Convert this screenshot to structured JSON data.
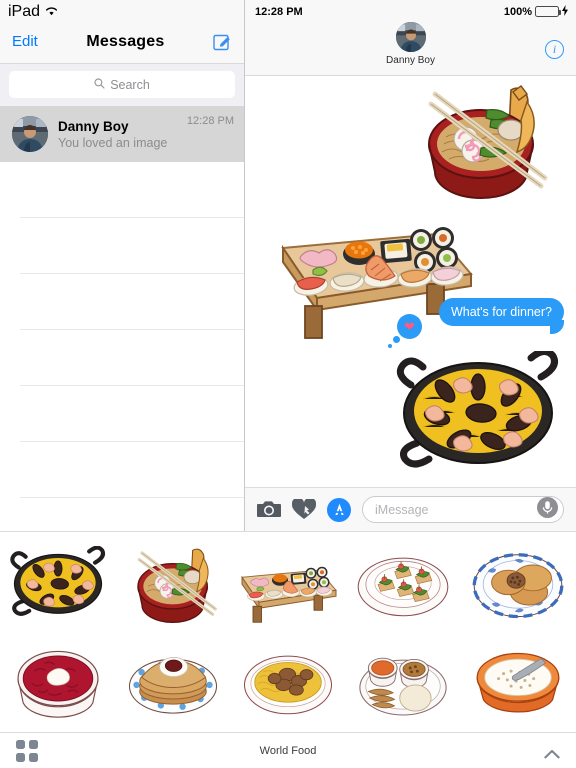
{
  "sidebar": {
    "status": {
      "device": "iPad",
      "wifi_icon": "wifi-icon"
    },
    "navbar": {
      "edit_label": "Edit",
      "title": "Messages",
      "compose_icon": "compose-icon"
    },
    "search": {
      "placeholder": "Search",
      "icon": "search-icon"
    },
    "conversations": [
      {
        "name": "Danny Boy",
        "preview": "You loved an image",
        "time": "12:28 PM",
        "selected": true
      }
    ],
    "empty_rows": 6
  },
  "conversation": {
    "status": {
      "time": "12:28 PM",
      "battery_percent": "100%",
      "battery_icon": "battery-charging-icon",
      "battery_color": "#4cd964"
    },
    "header": {
      "contact_name": "Danny Boy",
      "avatar": "contact-avatar",
      "info_label": "i"
    },
    "messages": [
      {
        "type": "sticker",
        "name": "ramen-bowl-sticker"
      },
      {
        "type": "sticker",
        "name": "sushi-board-sticker"
      },
      {
        "type": "text",
        "text": "What's for dinner?",
        "sent": true,
        "reaction": "heart"
      },
      {
        "type": "sticker",
        "name": "paella-sticker"
      }
    ],
    "input_bar": {
      "camera_icon": "camera-icon",
      "digital_touch_icon": "heart-hand-icon",
      "app_store_icon": "app-store-icon",
      "field_placeholder": "iMessage",
      "mic_icon": "microphone-icon"
    },
    "accent_color": "#2a9bf7"
  },
  "sticker_tray": {
    "title": "World Food",
    "apps_icon": "app-grid-icon",
    "collapse_icon": "chevron-up-icon",
    "stickers": [
      {
        "name": "paella-sticker",
        "label": "Paella"
      },
      {
        "name": "ramen-sticker",
        "label": "Ramen"
      },
      {
        "name": "sushi-board-sticker",
        "label": "Sushi"
      },
      {
        "name": "canapes-sticker",
        "label": "Canapes"
      },
      {
        "name": "dorayaki-sticker",
        "label": "Dorayaki"
      },
      {
        "name": "borscht-sticker",
        "label": "Borscht"
      },
      {
        "name": "pancakes-sticker",
        "label": "Pancakes"
      },
      {
        "name": "couscous-sticker",
        "label": "Couscous"
      },
      {
        "name": "thali-sticker",
        "label": "Thali"
      },
      {
        "name": "porridge-sticker",
        "label": "Porridge"
      }
    ]
  }
}
